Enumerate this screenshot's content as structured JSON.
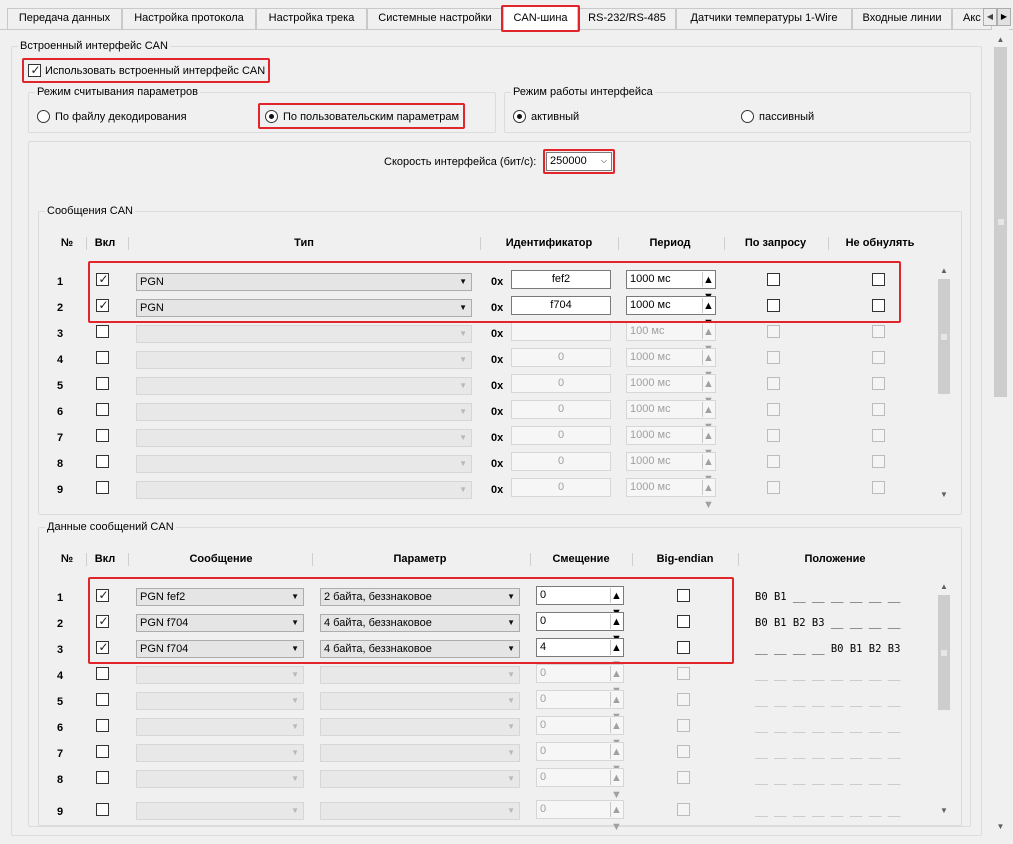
{
  "tabs": [
    "Передача данных",
    "Настройка протокола",
    "Настройка трека",
    "Системные настройки",
    "CAN-шина",
    "RS-232/RS-485",
    "Датчики температуры 1-Wire",
    "Входные линии",
    "Акс"
  ],
  "active_tab": "CAN-шина",
  "builtin": {
    "group_title": "Встроенный интерфейс CAN",
    "use_builtin_label": "Использовать встроенный интерфейс CAN",
    "use_builtin_checked": true
  },
  "read_mode": {
    "title": "Режим считывания параметров",
    "option_file": "По файлу декодирования",
    "option_user": "По пользовательским параметрам",
    "selected": "user"
  },
  "work_mode": {
    "title": "Режим работы интерфейса",
    "option_active": "активный",
    "option_passive": "пассивный",
    "selected": "active"
  },
  "speed": {
    "label": "Скорость интерфейса (бит/с):",
    "value": "250000"
  },
  "can_messages": {
    "title": "Сообщения CAN",
    "headers": {
      "num": "№",
      "on": "Вкл",
      "type": "Тип",
      "id": "Идентификатор",
      "period": "Период",
      "on_request": "По запросу",
      "no_reset": "Не обнулять"
    },
    "hex_prefix": "0x",
    "rows": [
      {
        "num": "1",
        "on": true,
        "type": "PGN",
        "id": "fef2",
        "period": "1000 мс",
        "on_request": false,
        "no_reset": false,
        "enabled": true
      },
      {
        "num": "2",
        "on": true,
        "type": "PGN",
        "id": "f704",
        "period": "1000 мс",
        "on_request": false,
        "no_reset": false,
        "enabled": true
      },
      {
        "num": "3",
        "on": false,
        "type": "",
        "id": "",
        "period": "100 мс",
        "on_request": false,
        "no_reset": false,
        "enabled": false
      },
      {
        "num": "4",
        "on": false,
        "type": "",
        "id": "0",
        "period": "1000 мс",
        "on_request": false,
        "no_reset": false,
        "enabled": false
      },
      {
        "num": "5",
        "on": false,
        "type": "",
        "id": "0",
        "period": "1000 мс",
        "on_request": false,
        "no_reset": false,
        "enabled": false
      },
      {
        "num": "6",
        "on": false,
        "type": "",
        "id": "0",
        "period": "1000 мс",
        "on_request": false,
        "no_reset": false,
        "enabled": false
      },
      {
        "num": "7",
        "on": false,
        "type": "",
        "id": "0",
        "period": "1000 мс",
        "on_request": false,
        "no_reset": false,
        "enabled": false
      },
      {
        "num": "8",
        "on": false,
        "type": "",
        "id": "0",
        "period": "1000 мс",
        "on_request": false,
        "no_reset": false,
        "enabled": false
      },
      {
        "num": "9",
        "on": false,
        "type": "",
        "id": "0",
        "period": "1000 мс",
        "on_request": false,
        "no_reset": false,
        "enabled": false
      }
    ]
  },
  "can_data": {
    "title": "Данные сообщений CAN",
    "headers": {
      "num": "№",
      "on": "Вкл",
      "message": "Сообщение",
      "param": "Параметр",
      "offset": "Смещение",
      "big_endian": "Big-endian",
      "position": "Положение"
    },
    "rows": [
      {
        "num": "1",
        "on": true,
        "message": "PGN fef2",
        "param": "2 байта, беззнаковое",
        "offset": "0",
        "big_endian": false,
        "position": "B0 B1 __ __ __ __ __ __",
        "enabled": true
      },
      {
        "num": "2",
        "on": true,
        "message": "PGN f704",
        "param": "4 байта, беззнаковое",
        "offset": "0",
        "big_endian": false,
        "position": "B0 B1 B2 B3 __ __ __ __",
        "enabled": true
      },
      {
        "num": "3",
        "on": true,
        "message": "PGN f704",
        "param": "4 байта, беззнаковое",
        "offset": "4",
        "big_endian": false,
        "position": "__ __ __ __ B0 B1 B2 B3",
        "enabled": true
      },
      {
        "num": "4",
        "on": false,
        "message": "",
        "param": "",
        "offset": "0",
        "big_endian": false,
        "position": "__ __ __ __ __ __ __ __",
        "enabled": false
      },
      {
        "num": "5",
        "on": false,
        "message": "",
        "param": "",
        "offset": "0",
        "big_endian": false,
        "position": "__ __ __ __ __ __ __ __",
        "enabled": false
      },
      {
        "num": "6",
        "on": false,
        "message": "",
        "param": "",
        "offset": "0",
        "big_endian": false,
        "position": "__ __ __ __ __ __ __ __",
        "enabled": false
      },
      {
        "num": "7",
        "on": false,
        "message": "",
        "param": "",
        "offset": "0",
        "big_endian": false,
        "position": "__ __ __ __ __ __ __ __",
        "enabled": false
      },
      {
        "num": "8",
        "on": false,
        "message": "",
        "param": "",
        "offset": "0",
        "big_endian": false,
        "position": "__ __ __ __ __ __ __ __",
        "enabled": false
      },
      {
        "num": "9",
        "on": false,
        "message": "",
        "param": "",
        "offset": "0",
        "big_endian": false,
        "position": "__ __ __ __ __ __ __ __",
        "enabled": false
      }
    ]
  },
  "highlight_color": "#e0262a"
}
